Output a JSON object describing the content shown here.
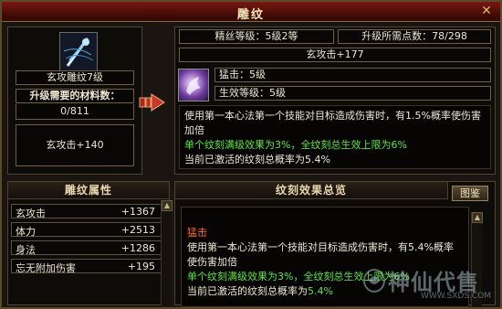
{
  "window": {
    "title": "雕纹"
  },
  "slot": {
    "item_name": "玄攻雕纹7级",
    "materials_label": "升级需要的材料数：",
    "materials_value": "0/811",
    "current_stat": "玄攻击+140"
  },
  "upgrade": {
    "level_label": "精丝等级：5级2等",
    "points_label": "升级所需点数：78/298",
    "next_stat": "玄攻击+177"
  },
  "gem": {
    "line1": "猛击：5级",
    "line2": "生效等级：5级",
    "description": "使用第一本心法第一个技能对目标造成伤害时，有1.5%概率使伤害加倍",
    "green_line": "单个纹刻满级效果为3%，全纹刻总生效上限为6%",
    "white_line": "当前已激活的纹刻总概率为5.4%"
  },
  "attributes": {
    "header": "雕纹属性",
    "rows": [
      {
        "name": "玄攻击",
        "value": "+1367"
      },
      {
        "name": "体力",
        "value": "+2513"
      },
      {
        "name": "身法",
        "value": "+1286"
      },
      {
        "name": "忘无附加伤害",
        "value": "+195"
      }
    ]
  },
  "summary": {
    "header": "纹刻效果总览",
    "button": "图鉴",
    "skill_name": "猛击",
    "description": "使用第一本心法第一个技能对目标造成伤害时，有5.4%概率使伤害加倍",
    "green_line": "单个纹刻满级效果为3%，全纹刻总生效上限为6%",
    "active_prefix": "当前已激活的纹刻总概率为",
    "active_value": "5.4%"
  },
  "watermark": {
    "text": "神仙代售",
    "url": "WWW.SXDS.COM"
  },
  "colors": {
    "accent": "#7a1810",
    "green": "#5ee640",
    "orange": "#ff6a28",
    "border": "#5a4a2a"
  }
}
